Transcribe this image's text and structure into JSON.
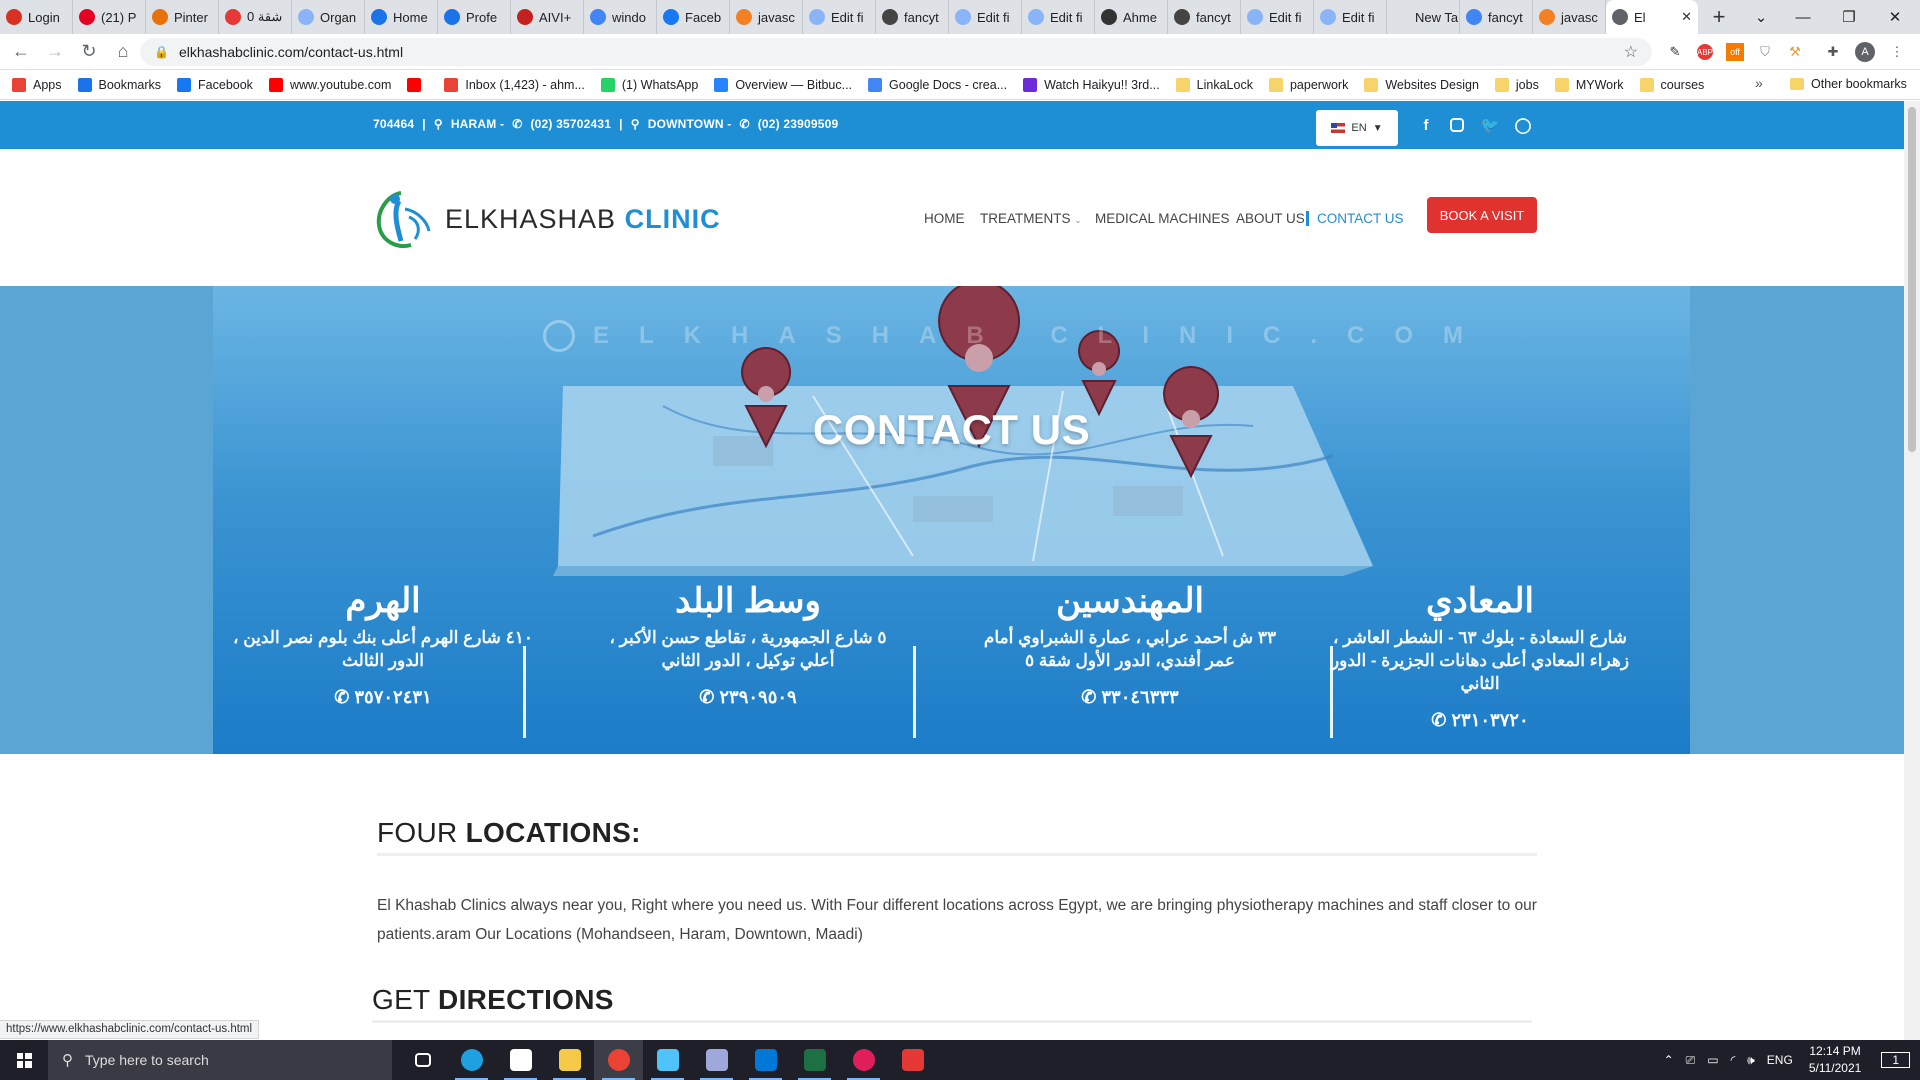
{
  "browser": {
    "tabs": [
      {
        "title": "Login",
        "color": "#d93025"
      },
      {
        "title": "(21) P",
        "color": "#e60023"
      },
      {
        "title": "Pinter",
        "color": "#e8710a"
      },
      {
        "title": "شقة 0",
        "color": "#e53935"
      },
      {
        "title": "Organ",
        "color": "#8ab4f8"
      },
      {
        "title": "Home",
        "color": "#1a73e8"
      },
      {
        "title": "Profe",
        "color": "#1a73e8"
      },
      {
        "title": "AIVI+",
        "color": "#c5221f"
      },
      {
        "title": "windo",
        "color": "#4285f4"
      },
      {
        "title": "Faceb",
        "color": "#1877f2"
      },
      {
        "title": "javasc",
        "color": "#f48024"
      },
      {
        "title": "Edit fi",
        "color": "#8ab4f8"
      },
      {
        "title": "fancyt",
        "color": "#444"
      },
      {
        "title": "Edit fi",
        "color": "#8ab4f8"
      },
      {
        "title": "Edit fi",
        "color": "#8ab4f8"
      },
      {
        "title": "Ahme",
        "color": "#333"
      },
      {
        "title": "fancyt",
        "color": "#444"
      },
      {
        "title": "Edit fi",
        "color": "#8ab4f8"
      },
      {
        "title": "Edit fi",
        "color": "#8ab4f8"
      },
      {
        "title": "New Tab",
        "color": "#dee1e6"
      },
      {
        "title": "fancyt",
        "color": "#4285f4"
      },
      {
        "title": "javasc",
        "color": "#f48024"
      }
    ],
    "active_tab": {
      "title": "El",
      "color": "#5f6368"
    },
    "url": "elkhashabclinic.com/contact-us.html",
    "bookmarks": [
      {
        "label": "Apps",
        "color": "#ea4335"
      },
      {
        "label": "Bookmarks",
        "color": "#1a73e8"
      },
      {
        "label": "Facebook",
        "color": "#1877f2"
      },
      {
        "label": "www.youtube.com",
        "color": "#ff0000"
      },
      {
        "label": "",
        "color": "#ff0000"
      },
      {
        "label": "Inbox (1,423) - ahm...",
        "color": "#ea4335"
      },
      {
        "label": "(1) WhatsApp",
        "color": "#25d366"
      },
      {
        "label": "Overview — Bitbuc...",
        "color": "#2684ff"
      },
      {
        "label": "Google Docs - crea...",
        "color": "#4285f4"
      },
      {
        "label": "Watch Haikyu!! 3rd...",
        "color": "#6c2bd9"
      },
      {
        "label": "LinkaLock",
        "color": "#f7d46a"
      },
      {
        "label": "paperwork",
        "color": "#f7d46a"
      },
      {
        "label": "Websites Design",
        "color": "#f7d46a"
      },
      {
        "label": "jobs",
        "color": "#f7d46a"
      },
      {
        "label": "MYWork",
        "color": "#f7d46a"
      },
      {
        "label": "courses",
        "color": "#f7d46a"
      }
    ],
    "other_bookmarks": "Other bookmarks",
    "status_url": "https://www.elkhashabclinic.com/contact-us.html"
  },
  "site": {
    "topbar": {
      "phone1": "704464",
      "sep": "|",
      "loc1": "HARAM - ",
      "phone2": "(02) 35702431",
      "loc2": "DOWNTOWN - ",
      "phone3": "(02) 23909509",
      "lang": "EN"
    },
    "colors": {
      "primary": "#1e8fd5",
      "book": "#e0332f"
    },
    "logo": {
      "text1": "ELKHASHAB ",
      "text2": "CLINIC"
    },
    "nav": [
      "HOME",
      "TREATMENTS",
      "MEDICAL MACHINES",
      "ABOUT US",
      "CONTACT US"
    ],
    "book_label": "BOOK A VISIT",
    "banner": {
      "watermark": "ELKHASHAB CLINIC.COM",
      "title": "CONTACT US",
      "locations": [
        {
          "name": "الهرم",
          "address": "٤١٠ شارع الهرم أعلى بنك بلوم نصر الدين ، الدور الثالث",
          "phone": "٣٥٧٠٢٤٣١"
        },
        {
          "name": "وسط البلد",
          "address": "٥ شارع الجمهورية ، تقاطع حسن الأكبر ، أعلي توكيل ، الدور الثاني",
          "phone": "٢٣٩٠٩٥٠٩"
        },
        {
          "name": "المهندسين",
          "address": "٣٣ ش أحمد عرابي ، عمارة الشبراوي أمام عمر أفندي، الدور الأول شقة ٥",
          "phone": "٣٣٠٤٦٣٣٣"
        },
        {
          "name": "المعادي",
          "address": "شارع السعادة - بلوك ٦٣ - الشطر العاشر ، زهراء المعادي أعلى دهانات الجزيرة - الدور الثاني",
          "phone": "٢٣١٠٣٧٢٠"
        }
      ]
    },
    "section1": {
      "title_light": "FOUR ",
      "title_bold": "LOCATIONS:"
    },
    "paragraph": "El Khashab Clinics always near you, Right where you need us. With Four different locations across Egypt, we are bringing physiotherapy machines and staff closer to our patients.aram Our Locations (Mohandseen, Haram, Downtown, Maadi)",
    "section2": {
      "title_light": "GET ",
      "title_bold": "DIRECTIONS"
    }
  },
  "taskbar": {
    "search_placeholder": "Type here to search",
    "apps": [
      {
        "name": "task-view",
        "color": "#ffffff"
      },
      {
        "name": "edge",
        "color": "#1fa0e0"
      },
      {
        "name": "store",
        "color": "#ffffff"
      },
      {
        "name": "file-explorer",
        "color": "#f7c948"
      },
      {
        "name": "chrome",
        "color": "#ea4335"
      },
      {
        "name": "terminal",
        "color": "#4fc3f7"
      },
      {
        "name": "network-tool",
        "color": "#9fa8da"
      },
      {
        "name": "vscode",
        "color": "#0078d7"
      },
      {
        "name": "excel",
        "color": "#1d7044"
      },
      {
        "name": "slack",
        "color": "#e01e5a"
      },
      {
        "name": "app-red",
        "color": "#e53935"
      }
    ],
    "lang": "ENG",
    "time": "12:14 PM",
    "date": "5/11/2021",
    "notifications": "1"
  }
}
